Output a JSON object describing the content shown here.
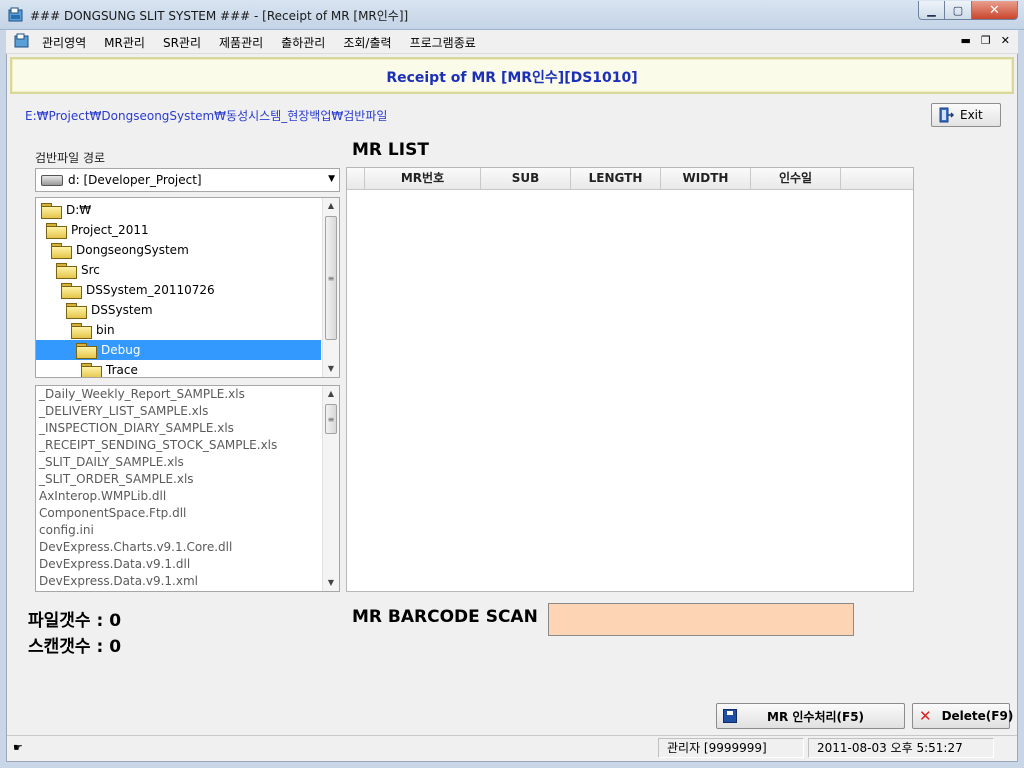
{
  "window": {
    "title": "### DONGSUNG SLIT SYSTEM ### - [Receipt of  MR [MR인수]]",
    "min_glyph": "▁",
    "max_glyph": "▢",
    "close_glyph": "✕"
  },
  "menu": {
    "items": [
      "관리영역",
      "MR관리",
      "SR관리",
      "제품관리",
      "출하관리",
      "조회/출력",
      "프로그램종료"
    ],
    "mdi_min": "▬",
    "mdi_restore": "❐",
    "mdi_close": "✕"
  },
  "header": {
    "title": "Receipt of  MR [MR인수][DS1010]"
  },
  "path": "E:₩Project₩DongseongSystem₩동성시스템_현장백업₩검반파일",
  "exit_button": {
    "label": "Exit",
    "icon": "exit-door-icon"
  },
  "left_panel": {
    "folder_label": "검반파일 경로",
    "drive": {
      "value": "d: [Developer_Project]"
    },
    "tree": [
      {
        "label": "D:₩",
        "indent": 0,
        "selected": false
      },
      {
        "label": "Project_2011",
        "indent": 1,
        "selected": false
      },
      {
        "label": "DongseongSystem",
        "indent": 2,
        "selected": false
      },
      {
        "label": "Src",
        "indent": 3,
        "selected": false
      },
      {
        "label": "DSSystem_20110726",
        "indent": 4,
        "selected": false
      },
      {
        "label": "DSSystem",
        "indent": 5,
        "selected": false
      },
      {
        "label": "bin",
        "indent": 6,
        "selected": false
      },
      {
        "label": "Debug",
        "indent": 7,
        "selected": true
      },
      {
        "label": "Trace",
        "indent": 8,
        "selected": false
      }
    ],
    "files": [
      "_Daily_Weekly_Report_SAMPLE.xls",
      "_DELIVERY_LIST_SAMPLE.xls",
      "_INSPECTION_DIARY_SAMPLE.xls",
      "_RECEIPT_SENDING_STOCK_SAMPLE.xls",
      "_SLIT_DAILY_SAMPLE.xls",
      "_SLIT_ORDER_SAMPLE.xls",
      "AxInterop.WMPLib.dll",
      "ComponentSpace.Ftp.dll",
      "config.ini",
      "DevExpress.Charts.v9.1.Core.dll",
      "DevExpress.Data.v9.1.dll",
      "DevExpress.Data.v9.1.xml"
    ],
    "file_count_text": "파일갯수 : 0",
    "scan_count_text": "스캔갯수 : 0"
  },
  "mr_list": {
    "title": "MR LIST",
    "columns": [
      "MR번호",
      "SUB",
      "LENGTH",
      "WIDTH",
      "인수일"
    ],
    "rows": []
  },
  "scan": {
    "label": "MR BARCODE SCAN",
    "value": ""
  },
  "actions": {
    "receipt_label": "MR 인수처리(F5)",
    "delete_label": "Delete(F9)",
    "delete_glyph": "✕"
  },
  "status": {
    "user": "관리자 [9999999]",
    "datetime": "2011-08-03 오후 5:51:27"
  },
  "colors": {
    "banner_text": "#1c2fb8",
    "path_text": "#2a3bcf",
    "selection": "#3399ff",
    "scan_field": "#fdd5b4"
  }
}
